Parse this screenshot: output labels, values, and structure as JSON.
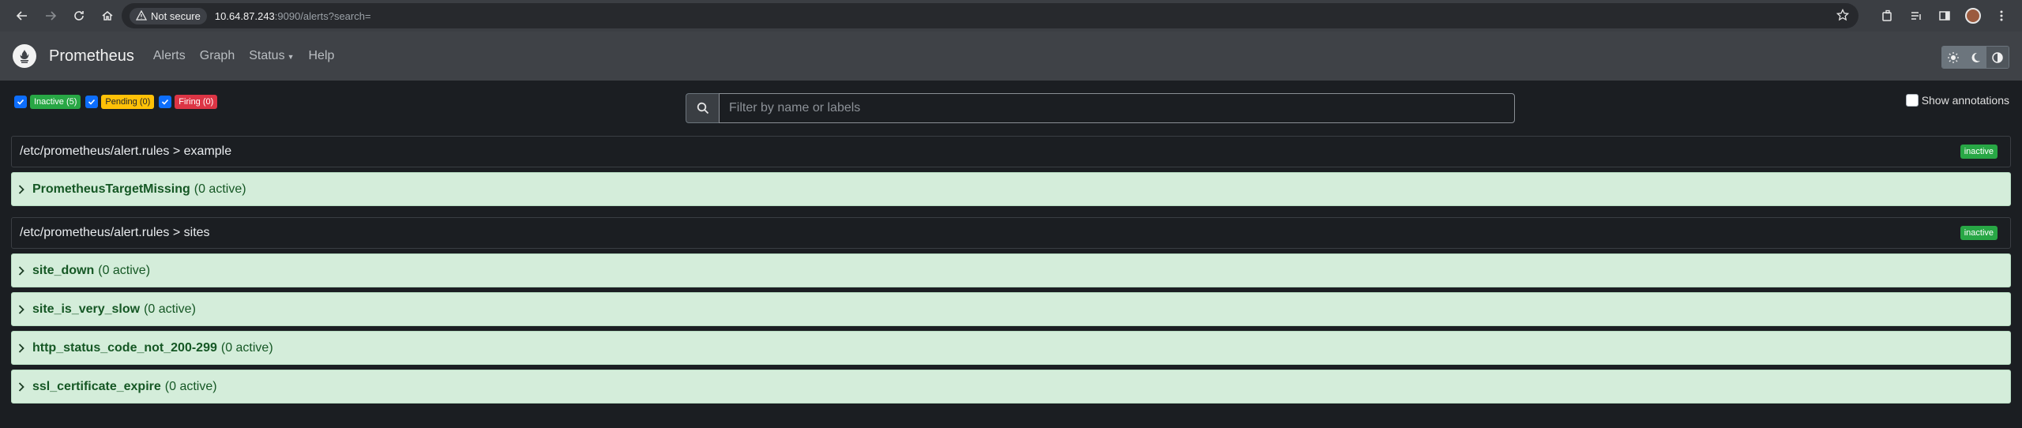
{
  "browser": {
    "security_label": "Not secure",
    "url_host": "10.64.87.243",
    "url_rest": ":9090/alerts?search="
  },
  "navbar": {
    "brand": "Prometheus",
    "links": [
      "Alerts",
      "Graph",
      "Status",
      "Help"
    ]
  },
  "filters": {
    "inactive": "Inactive (5)",
    "pending": "Pending (0)",
    "firing": "Firing (0)",
    "search_placeholder": "Filter by name or labels",
    "show_annotations": "Show annotations"
  },
  "groups": [
    {
      "path": "/etc/prometheus/alert.rules > example",
      "state": "inactive",
      "rules": [
        {
          "name": "PrometheusTargetMissing",
          "count": "(0 active)"
        }
      ]
    },
    {
      "path": "/etc/prometheus/alert.rules > sites",
      "state": "inactive",
      "rules": [
        {
          "name": "site_down",
          "count": "(0 active)"
        },
        {
          "name": "site_is_very_slow",
          "count": "(0 active)"
        },
        {
          "name": "http_status_code_not_200-299",
          "count": "(0 active)"
        },
        {
          "name": "ssl_certificate_expire",
          "count": "(0 active)"
        }
      ]
    }
  ],
  "colors": {
    "inactive": "#28a745",
    "pending": "#ffc107",
    "firing": "#dc3545",
    "rule_bg": "#d4edda"
  }
}
